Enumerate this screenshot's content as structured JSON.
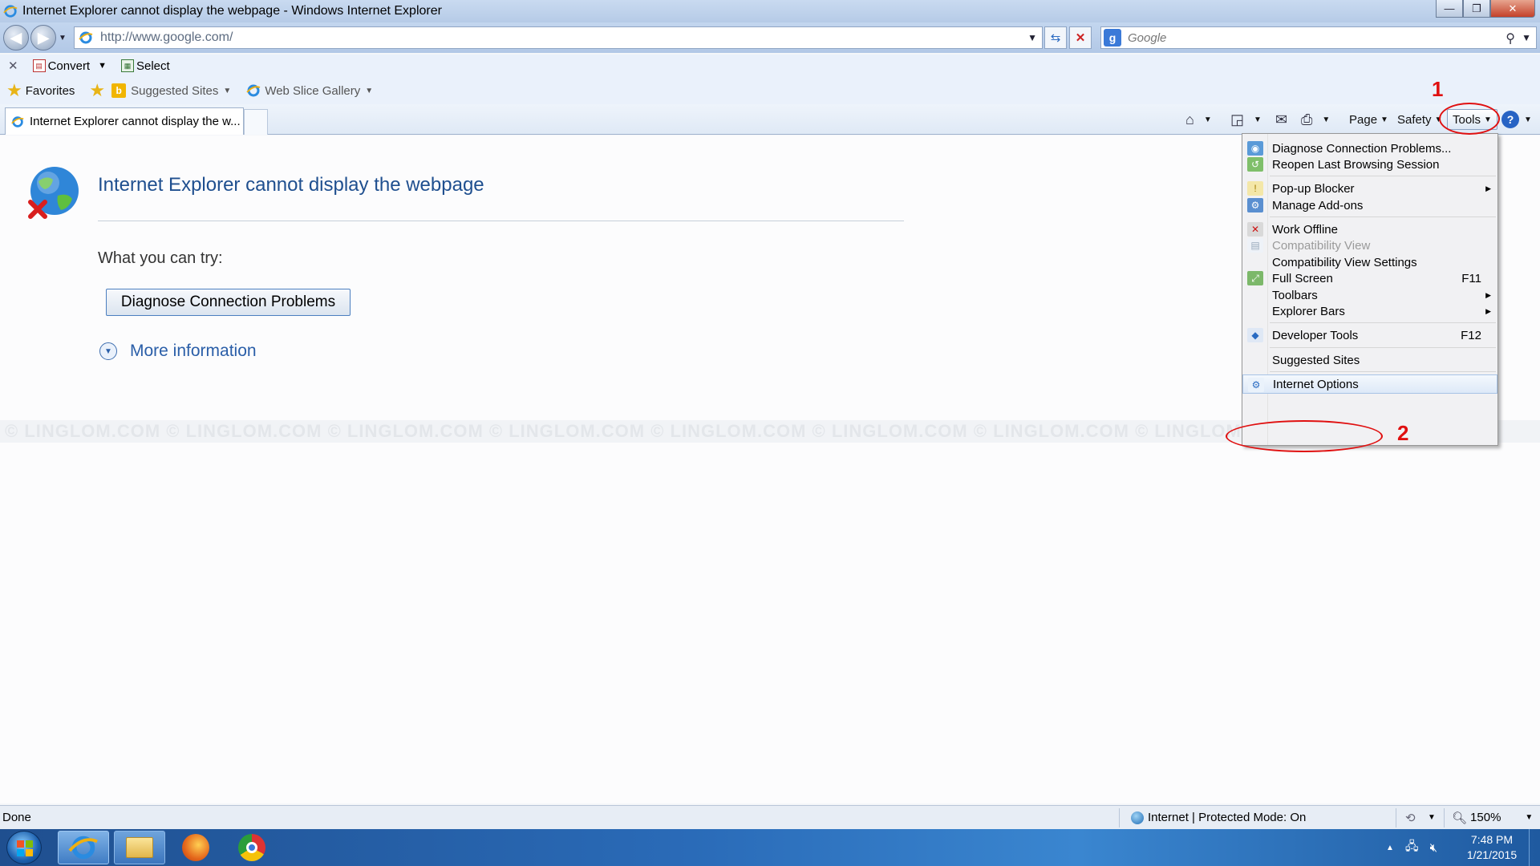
{
  "window": {
    "title": "Internet Explorer cannot display the webpage - Windows Internet Explorer",
    "buttons": {
      "minimize": "—",
      "maximize": "❐",
      "close": "✕"
    }
  },
  "address_bar": {
    "url": "http://www.google.com/",
    "search_placeholder": "Google",
    "search_provider_glyph": "g"
  },
  "convert_toolbar": {
    "close_glyph": "✕",
    "convert_label": "Convert",
    "select_label": "Select"
  },
  "favorites_bar": {
    "favorites_label": "Favorites",
    "suggested_sites_label": "Suggested Sites",
    "web_slice_label": "Web Slice Gallery"
  },
  "tab": {
    "title": "Internet Explorer cannot display the w..."
  },
  "command_bar": {
    "page_label": "Page",
    "safety_label": "Safety",
    "tools_label": "Tools",
    "help_glyph": "?"
  },
  "content": {
    "heading": "Internet Explorer cannot display the webpage",
    "what_you_can_try": "What you can try:",
    "diagnose_button": "Diagnose Connection Problems",
    "more_information": "More information",
    "watermark": "© LINGLOM.COM    © LINGLOM.COM    © LINGLOM.COM    © LINGLOM.COM    © LINGLOM.COM    © LINGLOM.COM    © LINGLOM.COM    © LINGLOM.COM    © LINGLOM.COM"
  },
  "tools_menu": {
    "items": [
      {
        "label": "Diagnose Connection Problems...",
        "icon": "diagnose-icon"
      },
      {
        "label": "Reopen Last Browsing Session",
        "icon": "reopen-session-icon"
      },
      {
        "label": "Pop-up Blocker",
        "icon": "popup-blocker-icon",
        "submenu": true
      },
      {
        "label": "Manage Add-ons",
        "icon": "addons-icon"
      },
      {
        "label": "Work Offline",
        "icon": "work-offline-icon"
      },
      {
        "label": "Compatibility View",
        "icon": "compatibility-view-icon",
        "disabled": true
      },
      {
        "label": "Compatibility View Settings"
      },
      {
        "label": "Full Screen",
        "icon": "full-screen-icon",
        "shortcut": "F11"
      },
      {
        "label": "Toolbars",
        "submenu": true
      },
      {
        "label": "Explorer Bars",
        "submenu": true
      },
      {
        "label": "Developer Tools",
        "icon": "developer-tools-icon",
        "shortcut": "F12"
      },
      {
        "label": "Suggested Sites"
      },
      {
        "label": "Internet Options",
        "icon": "internet-options-icon",
        "highlighted": true
      }
    ]
  },
  "annotations": {
    "step1": "1",
    "step2": "2",
    "color": "#e01010"
  },
  "status_bar": {
    "status": "Done",
    "zone": "Internet | Protected Mode: On",
    "zoom": "150%"
  },
  "taskbar": {
    "apps": [
      "internet-explorer",
      "windows-explorer",
      "firefox",
      "chrome"
    ],
    "time": "7:48 PM",
    "date": "1/21/2015"
  }
}
